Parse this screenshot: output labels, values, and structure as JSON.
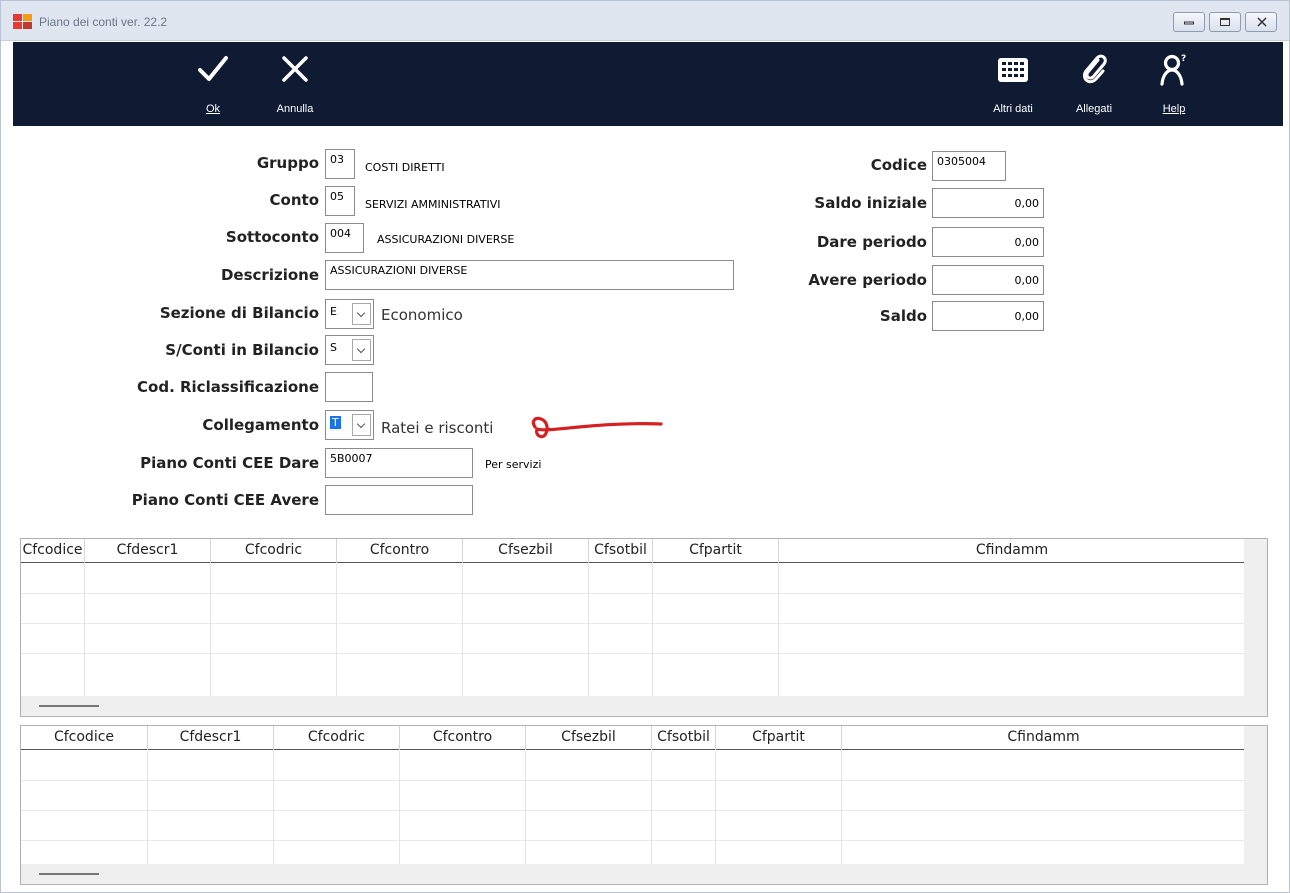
{
  "window": {
    "title": "Piano dei conti ver. 22.2",
    "icon_colors": [
      "#e8382f",
      "#f39c12",
      "#e8382f",
      "#c0392b"
    ]
  },
  "toolbar": {
    "ok_label": "Ok",
    "annulla_label": "Annulla",
    "altri_dati_label": "Altri dati",
    "allegati_label": "Allegati",
    "help_label": "Help",
    "background": "#0f1a33"
  },
  "form": {
    "gruppo": {
      "label": "Gruppo",
      "value": "03",
      "desc": "COSTI DIRETTI"
    },
    "conto": {
      "label": "Conto",
      "value": "05",
      "desc": "SERVIZI AMMINISTRATIVI"
    },
    "sottoconto": {
      "label": "Sottoconto",
      "value": "004",
      "desc": "ASSICURAZIONI DIVERSE"
    },
    "descrizione": {
      "label": "Descrizione",
      "value": "ASSICURAZIONI DIVERSE"
    },
    "sezione": {
      "label": "Sezione di Bilancio",
      "value": "E",
      "desc": "Economico"
    },
    "sconti": {
      "label": "S/Conti in Bilancio",
      "value": "S"
    },
    "codric": {
      "label": "Cod. Riclassificazione",
      "value": ""
    },
    "collegamento": {
      "label": "Collegamento",
      "value": "T",
      "desc": "Ratei e risconti"
    },
    "cee_dare": {
      "label": "Piano Conti CEE Dare",
      "value": "5B0007",
      "desc": "Per servizi"
    },
    "cee_avere": {
      "label": "Piano Conti CEE Avere",
      "value": ""
    },
    "codice": {
      "label": "Codice",
      "value": "0305004"
    },
    "saldo_iniziale": {
      "label": "Saldo iniziale",
      "value": "0,00"
    },
    "dare_periodo": {
      "label": "Dare periodo",
      "value": "0,00"
    },
    "avere_periodo": {
      "label": "Avere periodo",
      "value": "0,00"
    },
    "saldo": {
      "label": "Saldo",
      "value": "0,00"
    }
  },
  "grid1": {
    "columns": [
      "Cfcodice",
      "Cfdescr1",
      "Cfcodric",
      "Cfcontro",
      "Cfsezbil",
      "Cfsotbil",
      "Cfpartit",
      "Cfindamm"
    ]
  },
  "grid2": {
    "columns": [
      "Cfcodice",
      "Cfdescr1",
      "Cfcodric",
      "Cfcontro",
      "Cfsezbil",
      "Cfsotbil",
      "Cfpartit",
      "Cfindamm"
    ]
  },
  "annotation": {
    "color": "#d62020"
  }
}
